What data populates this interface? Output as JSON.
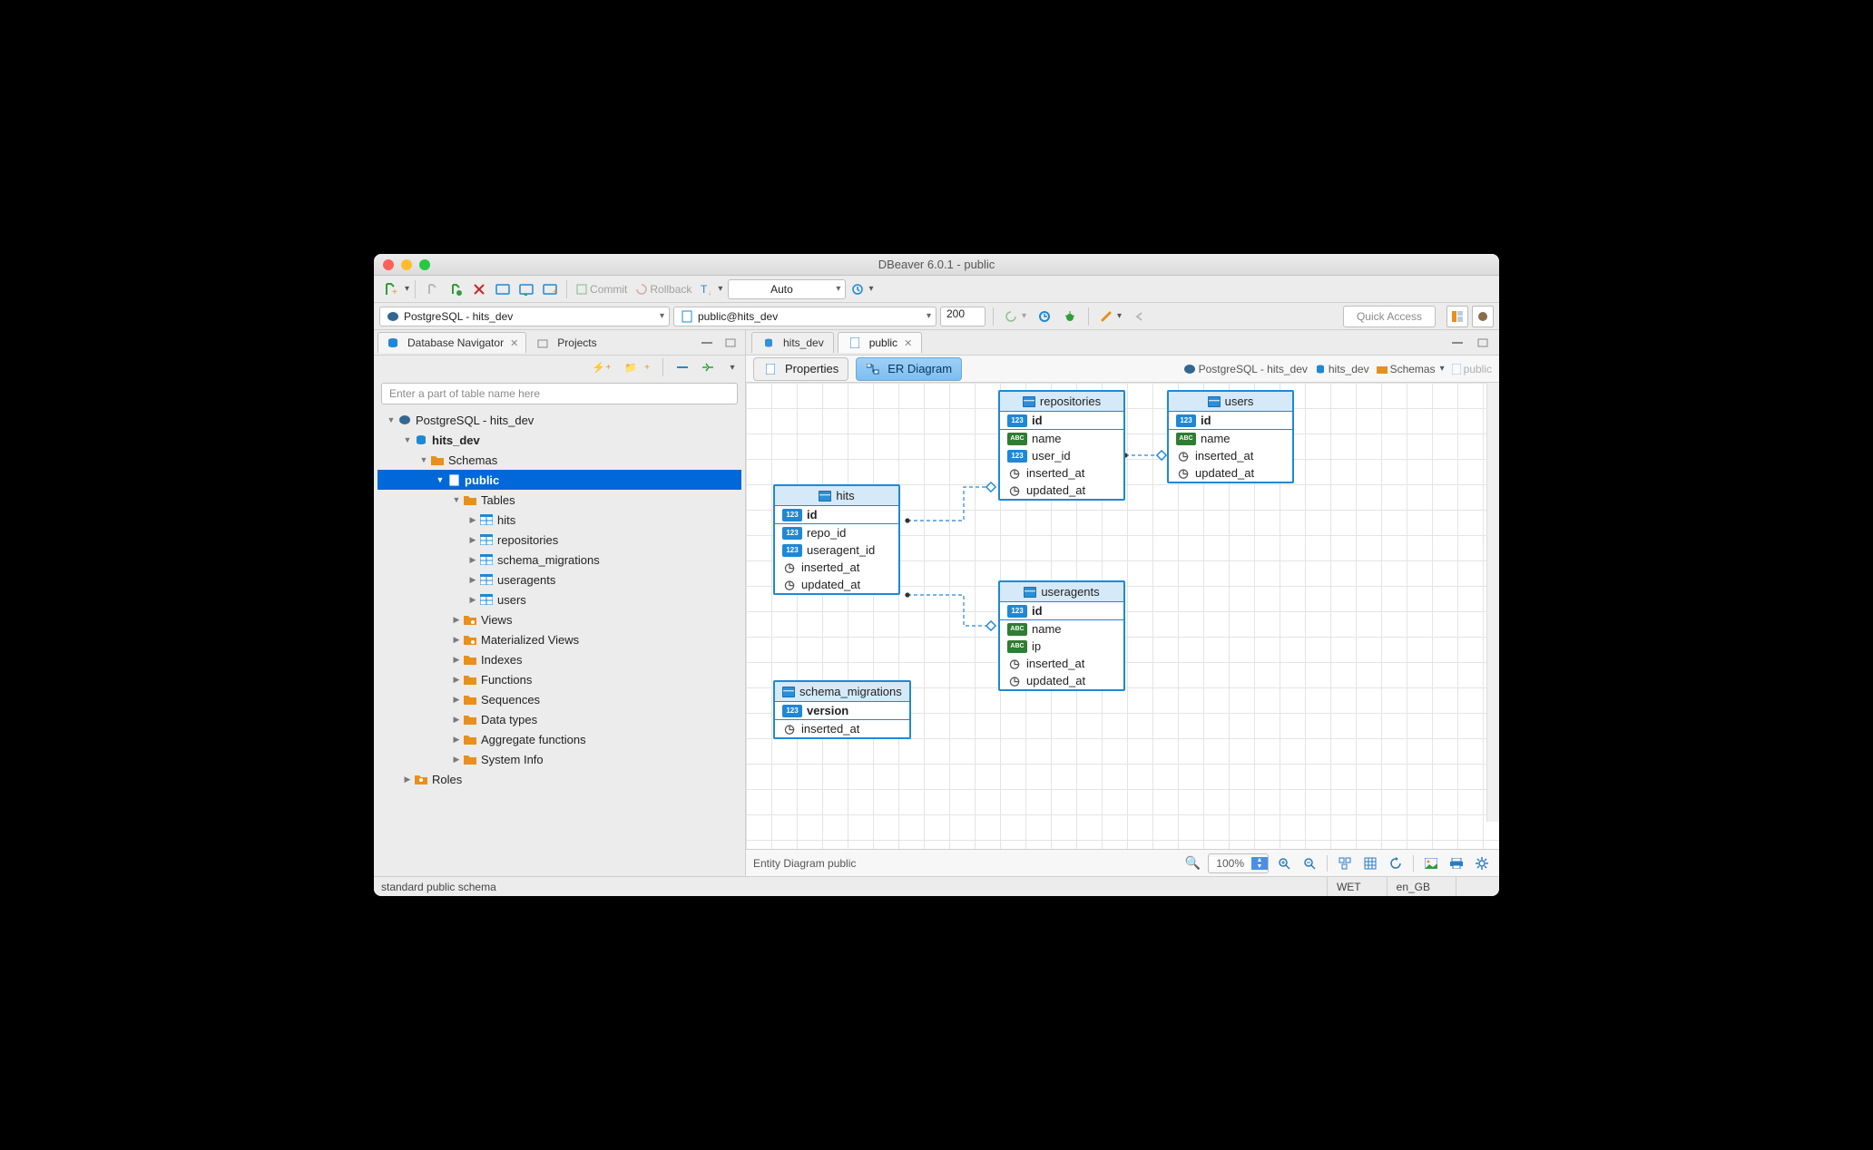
{
  "window_title": "DBeaver 6.0.1 - public",
  "toolbar": {
    "commit": "Commit",
    "rollback": "Rollback",
    "tx_mode": "Auto"
  },
  "toolbar2": {
    "connection": "PostgreSQL - hits_dev",
    "schema": "public@hits_dev",
    "limit": "200",
    "quick_access": "Quick Access"
  },
  "left": {
    "tabs": {
      "navigator": "Database Navigator",
      "projects": "Projects"
    },
    "filter_placeholder": "Enter a part of table name here"
  },
  "tree": {
    "root": "PostgreSQL - hits_dev",
    "db": "hits_dev",
    "schemas": "Schemas",
    "public": "public",
    "tables": "Tables",
    "tables_items": [
      "hits",
      "repositories",
      "schema_migrations",
      "useragents",
      "users"
    ],
    "groups": [
      "Views",
      "Materialized Views",
      "Indexes",
      "Functions",
      "Sequences",
      "Data types",
      "Aggregate functions",
      "System Info"
    ],
    "roles": "Roles"
  },
  "editor": {
    "tabs": [
      "hits_dev",
      "public"
    ],
    "subtabs": {
      "properties": "Properties",
      "er": "ER Diagram"
    },
    "breadcrumb": {
      "conn": "PostgreSQL - hits_dev",
      "db": "hits_dev",
      "schemas": "Schemas",
      "public": "public"
    }
  },
  "diagram": {
    "footer_label": "Entity Diagram  public",
    "zoom": "100%",
    "entities": {
      "hits": {
        "name": "hits",
        "columns": [
          {
            "t": "num",
            "n": "id",
            "pk": true
          },
          {
            "t": "num",
            "n": "repo_id"
          },
          {
            "t": "num",
            "n": "useragent_id"
          },
          {
            "t": "dt",
            "n": "inserted_at"
          },
          {
            "t": "dt",
            "n": "updated_at"
          }
        ]
      },
      "repositories": {
        "name": "repositories",
        "columns": [
          {
            "t": "num",
            "n": "id",
            "pk": true
          },
          {
            "t": "txt",
            "n": "name"
          },
          {
            "t": "num",
            "n": "user_id"
          },
          {
            "t": "dt",
            "n": "inserted_at"
          },
          {
            "t": "dt",
            "n": "updated_at"
          }
        ]
      },
      "users": {
        "name": "users",
        "columns": [
          {
            "t": "num",
            "n": "id",
            "pk": true
          },
          {
            "t": "txt",
            "n": "name"
          },
          {
            "t": "dt",
            "n": "inserted_at"
          },
          {
            "t": "dt",
            "n": "updated_at"
          }
        ]
      },
      "useragents": {
        "name": "useragents",
        "columns": [
          {
            "t": "num",
            "n": "id",
            "pk": true
          },
          {
            "t": "txt",
            "n": "name"
          },
          {
            "t": "txt",
            "n": "ip"
          },
          {
            "t": "dt",
            "n": "inserted_at"
          },
          {
            "t": "dt",
            "n": "updated_at"
          }
        ]
      },
      "schema_migrations": {
        "name": "schema_migrations",
        "columns": [
          {
            "t": "num",
            "n": "version",
            "pk": true
          },
          {
            "t": "dt",
            "n": "inserted_at"
          }
        ]
      }
    }
  },
  "status": {
    "text": "standard public schema",
    "tz": "WET",
    "locale": "en_GB"
  }
}
